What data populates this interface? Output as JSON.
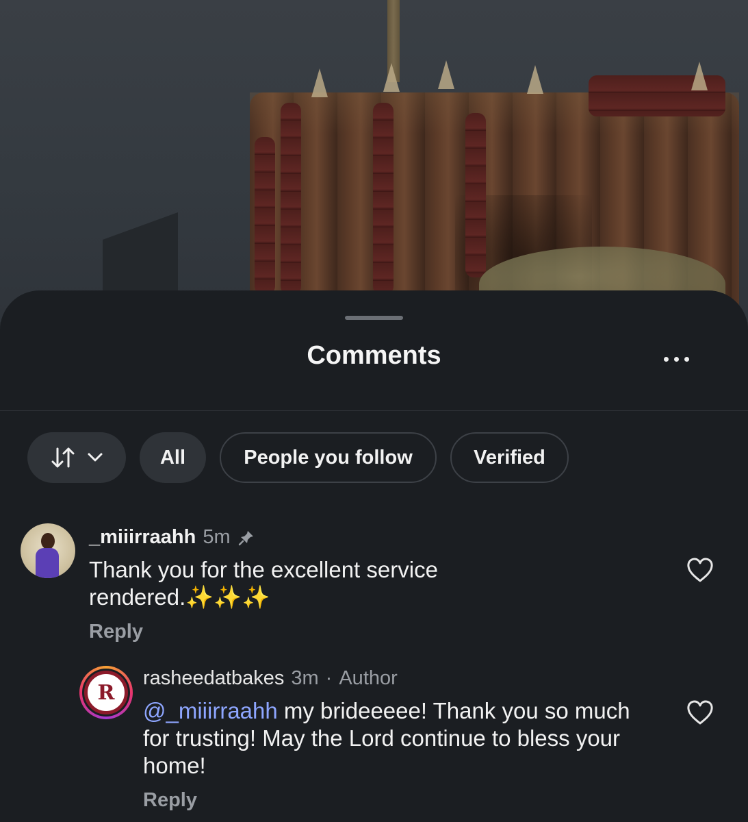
{
  "sheet": {
    "title": "Comments"
  },
  "filters": {
    "sort_icon": "sort-arrows-icon",
    "chips": [
      {
        "label": "All",
        "selected": true
      },
      {
        "label": "People you follow",
        "selected": false
      },
      {
        "label": "Verified",
        "selected": false
      }
    ]
  },
  "comments": [
    {
      "username": "_miiirraahh",
      "time": "5m",
      "pinned": true,
      "text": "Thank you for the excellent service rendered.✨✨✨",
      "reply_label": "Reply",
      "liked": false
    },
    {
      "username": "rasheedatbakes",
      "time": "3m",
      "separator": "·",
      "tag": "Author",
      "mention": "@_miiirraahh",
      "text": " my brideeeee! Thank you so much for trusting! May the Lord continue to bless your home!",
      "reply_label": "Reply",
      "liked": false,
      "avatar_letter": "R"
    }
  ],
  "colors": {
    "sheet_bg": "#1b1e22",
    "mention": "#8ea6ff",
    "secondary_text": "#9a9ea4"
  }
}
